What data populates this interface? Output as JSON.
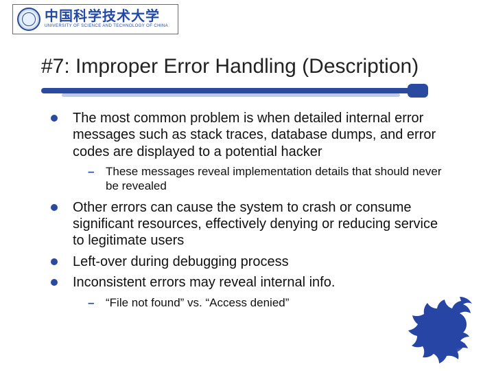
{
  "logo": {
    "cn": "中国科学技术大学",
    "en": "UNIVERSITY OF SCIENCE AND TECHNOLOGY OF CHINA"
  },
  "title": "#7: Improper Error Handling (Description)",
  "bullets": {
    "b1": "The most common problem is when detailed internal error messages such as stack traces, database dumps, and error codes are displayed to a potential hacker",
    "b1_sub1": "These messages reveal implementation details that should never be revealed",
    "b2": "Other errors can cause the system to crash or consume significant resources, effectively denying or reducing service to legitimate users",
    "b3": "Left-over during debugging process",
    "b4": "Inconsistent errors may reveal internal info.",
    "b4_sub1": "“File not found” vs. “Access denied”"
  }
}
